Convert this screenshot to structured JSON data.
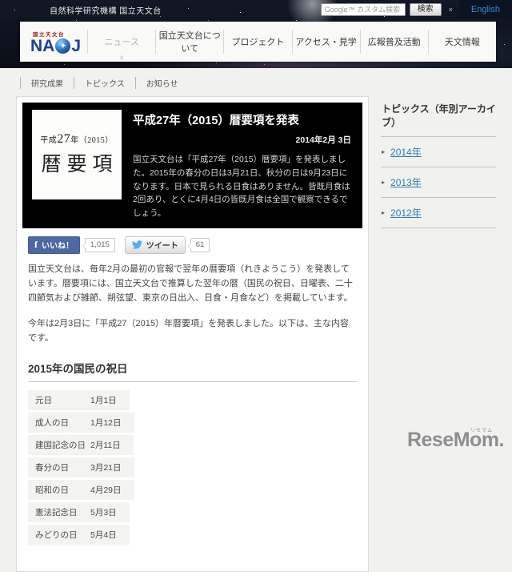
{
  "topbar": {
    "site_name": "自然科学研究機構 国立天文台",
    "search_placeholder": "Google™ カスタム検索",
    "search_button": "検索",
    "close_mark": "×",
    "english_link": "English"
  },
  "nav": {
    "logo": {
      "kanji": "国立天文台",
      "na": "NA",
      "j": "J",
      "star": "✦"
    },
    "active_caret": "∧",
    "items": [
      {
        "label": "ニュース"
      },
      {
        "label": "国立天文台について"
      },
      {
        "label": "プロジェクト"
      },
      {
        "label": "アクセス・見学"
      },
      {
        "label": "広報普及活動"
      },
      {
        "label": "天文情報"
      }
    ]
  },
  "breadcrumb": {
    "items": [
      "研究成果",
      "トピックス",
      "お知らせ"
    ]
  },
  "article": {
    "thumb": {
      "era_prefix": "平成",
      "era_num": "27",
      "era_suffix": "年（2015）",
      "title": "暦要項"
    },
    "title": "平成27年（2015）暦要項を発表",
    "date": "2014年2月 3日",
    "summary": "国立天文台は「平成27年（2015）暦要項」を発表しました。2015年の春分の日は3月21日、秋分の日は9月23日になります。日本で見られる日食はありません。皆既月食は2回あり、とくに4月4日の皆既月食は全国で観察できるでしょう。",
    "paragraph1": "国立天文台は、毎年2月の最初の官報で翌年の暦要項（れきようこう）を発表しています。暦要項には、国立天文台で推算した翌年の暦（国民の祝日、日曜表、二十四節気および雑節、朔弦望、東京の日出入、日食・月食など）を掲載しています。",
    "paragraph2": "今年は2月3日に「平成27（2015）年暦要項」を発表しました。以下は、主な内容です。",
    "holidays_heading": "2015年の国民の祝日",
    "holidays": [
      {
        "name": "元日",
        "date": "1月1日"
      },
      {
        "name": "成人の日",
        "date": "1月12日"
      },
      {
        "name": "建国記念の日",
        "date": "2月11日"
      },
      {
        "name": "春分の日",
        "date": "3月21日"
      },
      {
        "name": "昭和の日",
        "date": "4月29日"
      },
      {
        "name": "憲法記念日",
        "date": "5月3日"
      },
      {
        "name": "みどりの日",
        "date": "5月4日"
      }
    ]
  },
  "social": {
    "fb_icon": "f",
    "like_label": "いいね！",
    "like_count": "1,015",
    "tweet_label": "ツイート",
    "tweet_count": "61"
  },
  "sidebar": {
    "title": "トピックス（年別アーカイブ）",
    "bullet": "▸",
    "years": [
      "2014年",
      "2013年",
      "2012年"
    ]
  },
  "watermark": {
    "text": "ReseMom.",
    "ruby": "リセマム"
  },
  "colors": {
    "accent_blue": "#1d3f94",
    "link_blue": "#2e7fb0",
    "fb_blue": "#4e69a2",
    "twitter_blue": "#55acee",
    "logo_red": "#a8201f"
  }
}
